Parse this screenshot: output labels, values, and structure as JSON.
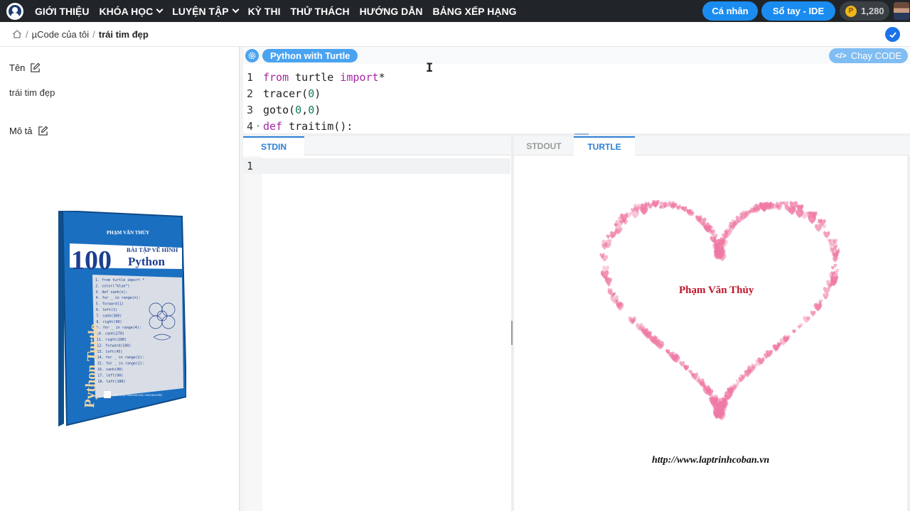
{
  "nav": {
    "items": [
      {
        "label": "GIỚI THIỆU",
        "dropdown": false
      },
      {
        "label": "KHÓA HỌC",
        "dropdown": true
      },
      {
        "label": "LUYỆN TẬP",
        "dropdown": true
      },
      {
        "label": "KỲ THI",
        "dropdown": false
      },
      {
        "label": "THỬ THÁCH",
        "dropdown": false
      },
      {
        "label": "HƯỚNG DẪN",
        "dropdown": false
      },
      {
        "label": "BẢNG XẾP HẠNG",
        "dropdown": false
      }
    ],
    "personal_label": "Cá nhân",
    "notebook_label": "Sổ tay - IDE",
    "coins": "1,280",
    "coin_symbol": "P"
  },
  "breadcrumb": {
    "items": [
      "µCode của tôi"
    ],
    "current": "trái tim đẹp"
  },
  "left_panel": {
    "name_label": "Tên",
    "name_value": "trái tim đẹp",
    "desc_label": "Mô tả",
    "book": {
      "author": "PHẠM VĂN THỦY",
      "number": "100",
      "subtitle": "BÀI TẬP VẼ HÌNH",
      "lang": "Python",
      "spine": "Python Turtle",
      "code_lines": [
        "1. from turtle import *",
        "2. color(\"blue\")",
        "3. def canh(n):",
        "4.     for _ in range(n):",
        "5.         forward(1)",
        "6.         left(1)",
        "7. canh(360)",
        "8. right(90)",
        "9. for _ in range(4):",
        "10.     canh(270)",
        "11.     right(180)",
        "12. forward(100)",
        "13. left(45)",
        "14. for _ in range(2):",
        "15.     for _ in range(2):",
        "16.         canh(90)",
        "17.         left(90)",
        "18.     left(180)"
      ],
      "publisher": "NHÀ XUẤT BẢN ĐẠI HỌC THÁI NGUYÊN"
    }
  },
  "editor": {
    "language": "Python with Turtle",
    "run_label": "Chạy CODE",
    "run_glyph": "</>",
    "cursor_glyph": "I",
    "lines": [
      {
        "num": "1",
        "tokens": [
          {
            "t": "from",
            "c": "kw"
          },
          {
            "t": " turtle ",
            "c": "fn"
          },
          {
            "t": "import",
            "c": "kw"
          },
          {
            "t": "*",
            "c": "fn"
          }
        ]
      },
      {
        "num": "2",
        "tokens": [
          {
            "t": "tracer(",
            "c": "fn"
          },
          {
            "t": "0",
            "c": "num"
          },
          {
            "t": ")",
            "c": "fn"
          }
        ]
      },
      {
        "num": "3",
        "tokens": [
          {
            "t": "goto(",
            "c": "fn"
          },
          {
            "t": "0",
            "c": "num"
          },
          {
            "t": ",",
            "c": "fn"
          },
          {
            "t": "0",
            "c": "num"
          },
          {
            "t": ")",
            "c": "fn"
          }
        ]
      },
      {
        "num": "4",
        "fold": "▾",
        "tokens": [
          {
            "t": "def",
            "c": "kw"
          },
          {
            "t": " traitim",
            "c": "fn"
          },
          {
            "t": "():",
            "c": "fn"
          }
        ]
      }
    ]
  },
  "io": {
    "stdin_tab": "STDIN",
    "stdin_line": "1",
    "stdout_tab": "STDOUT",
    "turtle_tab": "TURTLE",
    "author_name": "Phạm Văn Thủy",
    "site_url": "http://www.laptrinhcoban.vn"
  },
  "colors": {
    "nav_bg": "#212529",
    "accent": "#1a8cf0",
    "heart_pink": "#ef7aa5",
    "keyword": "#a626a4",
    "number": "#0f7c5a"
  }
}
